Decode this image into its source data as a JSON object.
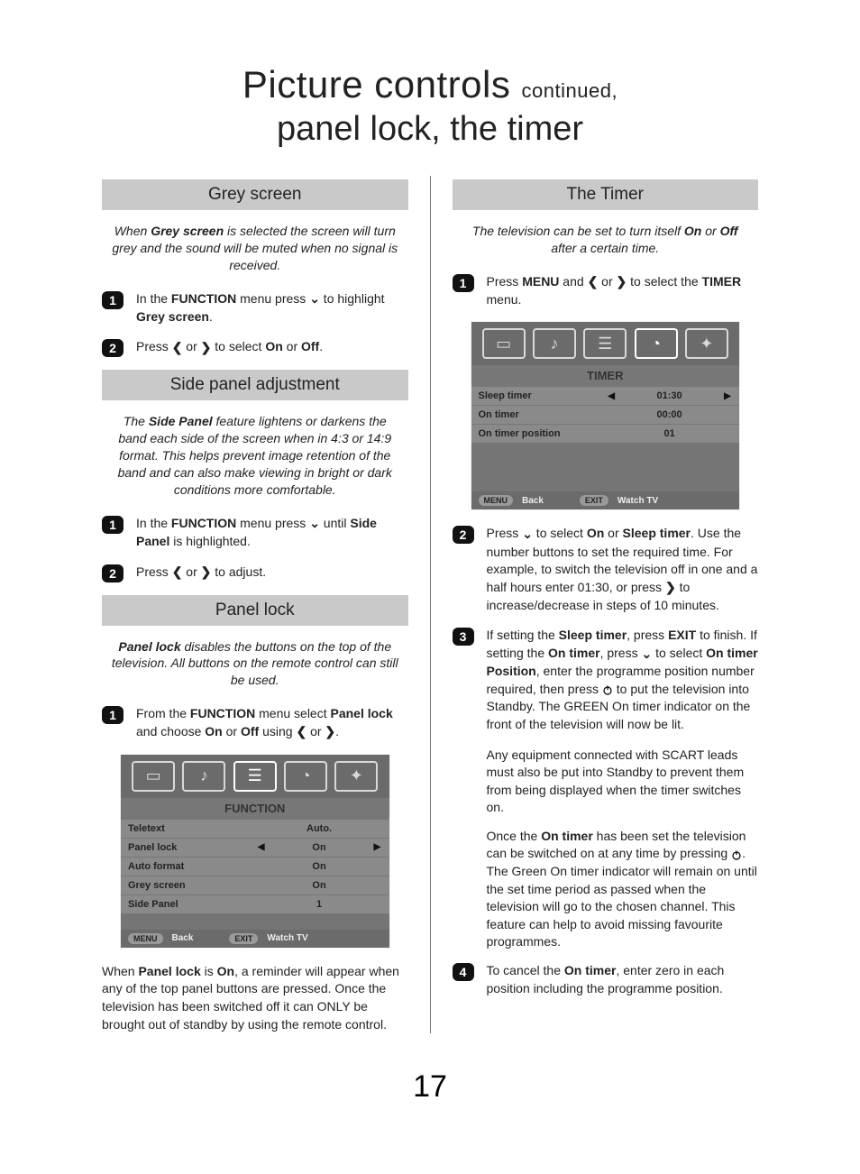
{
  "page_number": "17",
  "title": {
    "main": "Picture controls",
    "cont": "continued",
    "comma": ",",
    "sub": "panel lock, the timer"
  },
  "left": {
    "grey": {
      "header": "Grey screen",
      "intro_pre": "When ",
      "intro_b": "Grey screen",
      "intro_post": " is selected the screen will turn grey and the sound will be muted when no signal is received.",
      "s1": {
        "pre": "In the ",
        "b1": "FUNCTION",
        "mid": " menu press ",
        "sym": "❯",
        "post1": " to highlight ",
        "b2": "Grey screen",
        "dot": "."
      },
      "s2": {
        "pre": "Press ",
        "mid": " or ",
        "post": " to select ",
        "b1": "On",
        "or": " or ",
        "b2": "Off",
        "dot": "."
      }
    },
    "side": {
      "header": "Side panel adjustment",
      "intro_pre": "The ",
      "intro_b": "Side Panel",
      "intro_post": " feature lightens or darkens the band each side of the screen when in 4:3 or 14:9 format. This helps prevent image retention of the band and can also make viewing in bright or dark conditions more comfortable.",
      "s1": {
        "pre": "In the ",
        "b1": "FUNCTION",
        "mid": " menu press ",
        "post": " until ",
        "b2": "Side Panel",
        "end": " is highlighted."
      },
      "s2": {
        "pre": "Press ",
        "mid": " or ",
        "post": " to adjust."
      }
    },
    "panel": {
      "header": "Panel lock",
      "intro_b": "Panel lock",
      "intro_post": " disables the buttons on the top of the television. All buttons on the remote control can still be used.",
      "s1": {
        "pre": "From the ",
        "b1": "FUNCTION",
        "mid": " menu select ",
        "b2": "Panel lock",
        "mid2": " and choose ",
        "b3": "On",
        "or": " or ",
        "b4": "Off",
        "using": " using ",
        "or2": " or ",
        "dot": "."
      },
      "osd": {
        "title": "FUNCTION",
        "rows": [
          {
            "label": "Teletext",
            "val": "Auto.",
            "sel": false
          },
          {
            "label": "Panel lock",
            "val": "On",
            "sel": true
          },
          {
            "label": "Auto format",
            "val": "On",
            "sel": false
          },
          {
            "label": "Grey screen",
            "val": "On",
            "sel": false
          },
          {
            "label": "Side Panel",
            "val": "1",
            "sel": false
          }
        ],
        "footer": {
          "menu": "MENU",
          "back": "Back",
          "exit": "EXIT",
          "watch": "Watch TV"
        }
      },
      "after_pre": "When ",
      "after_b": "Panel lock",
      "after_mid": " is ",
      "after_b2": "On",
      "after_post": ", a reminder will appear when any of the top panel buttons are pressed. Once the television has been switched off it can ONLY be brought out of standby by using the remote control."
    }
  },
  "right": {
    "timer": {
      "header": "The Timer",
      "intro_pre": "The television can be set to turn itself ",
      "intro_b1": "On",
      "intro_or": " or ",
      "intro_b2": "Off",
      "intro_post": " after a certain time.",
      "s1": {
        "pre": "Press ",
        "b1": "MENU",
        "mid": " and ",
        "or": " or ",
        "post": " to select the ",
        "b2": "TIMER",
        "end": " menu."
      },
      "osd": {
        "title": "TIMER",
        "rows": [
          {
            "label": "Sleep timer",
            "val": "01:30",
            "sel": true
          },
          {
            "label": "On timer",
            "val": "00:00",
            "sel": false
          },
          {
            "label": "On timer position",
            "val": "01",
            "sel": false
          }
        ],
        "footer": {
          "menu": "MENU",
          "back": "Back",
          "exit": "EXIT",
          "watch": "Watch TV"
        }
      },
      "s2": {
        "pre": "Press ",
        "mid": " to select ",
        "b1": "On",
        "or": " or ",
        "b2": "Sleep timer",
        "post": ". Use the number buttons to set the required time. For example, to switch the television off in one and a half hours enter 01:30, or press ",
        "post2": " to increase/decrease in steps of 10 minutes."
      },
      "s3": {
        "pre": "If setting the ",
        "b1": "Sleep timer",
        "mid": ", press ",
        "b2": "EXIT",
        "mid2": " to finish. If setting the ",
        "b3": "On timer",
        "mid3": ", press ",
        "mid4": " to select ",
        "b4": "On timer Position",
        "mid5": ", enter the programme position number required, then press ",
        "mid6": " to put the television into Standby. The GREEN On timer indicator on the front of the television will now be lit."
      },
      "para1": "Any equipment connected with SCART leads must also be put into Standby to prevent them from being displayed when the timer switches on.",
      "para2_pre": "Once the ",
      "para2_b": "On timer",
      "para2_mid": " has been set the television can be switched on at any time by pressing ",
      "para2_post": ". The Green On timer indicator will remain on until the set time period as passed when the television will go to the chosen channel. This feature can help to avoid missing favourite programmes.",
      "s4": {
        "pre": "To cancel the ",
        "b1": "On timer",
        "post": ", enter zero in each position including the programme position."
      }
    }
  }
}
